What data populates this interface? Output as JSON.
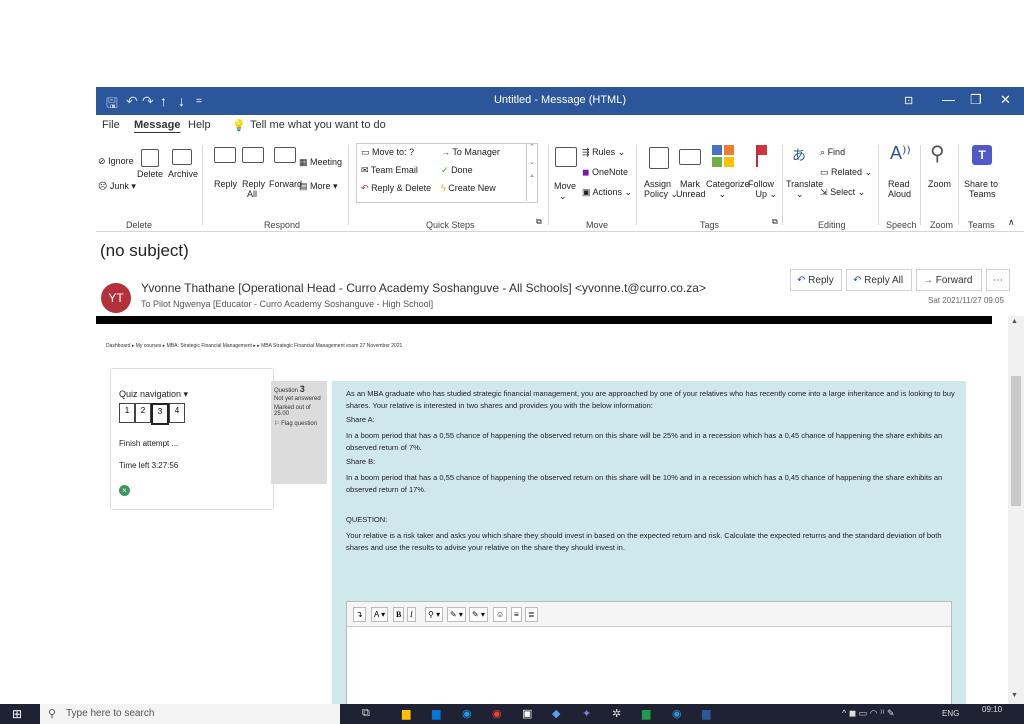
{
  "window": {
    "title": "Untitled  -  Message (HTML)"
  },
  "ribbon_tabs": [
    "File",
    "Message",
    "Help"
  ],
  "tell_me": "Tell me what you want to do",
  "ribbon": {
    "delete": {
      "ignore": "Ignore",
      "junk": "Junk",
      "delete": "Delete",
      "archive": "Archive",
      "group": "Delete"
    },
    "respond": {
      "reply": "Reply",
      "reply_all_1": "Reply",
      "reply_all_2": "All",
      "forward": "Forward",
      "meeting": "Meeting",
      "more": "More",
      "group": "Respond"
    },
    "quick_steps": {
      "move_to": "Move to: ?",
      "team_email": "Team Email",
      "reply_delete": "Reply & Delete",
      "to_manager": "To Manager",
      "done": "Done",
      "create_new": "Create New",
      "group": "Quick Steps"
    },
    "move": {
      "rules": "Rules",
      "onenote": "OneNote",
      "move": "Move",
      "actions": "Actions",
      "group": "Move"
    },
    "tags": {
      "assign_1": "Assign",
      "assign_2": "Policy",
      "mark_1": "Mark",
      "mark_2": "Unread",
      "categorize": "Categorize",
      "follow_1": "Follow",
      "follow_2": "Up",
      "group": "Tags"
    },
    "editing": {
      "translate": "Translate",
      "find": "Find",
      "related": "Related",
      "select": "Select",
      "group": "Editing"
    },
    "speech": {
      "read_1": "Read",
      "read_2": "Aloud",
      "group": "Speech"
    },
    "zoom": {
      "zoom": "Zoom",
      "group": "Zoom"
    },
    "teams": {
      "share_1": "Share to",
      "share_2": "Teams",
      "group": "Teams"
    }
  },
  "message": {
    "subject": "(no subject)",
    "avatar": "YT",
    "from": "Yvonne Thathane [Operational Head - Curro Academy Soshanguve - All Schools] <yvonne.t@curro.co.za>",
    "to": "To   Pilot Ngwenya [Educator - Curro Academy Soshanguve - High School]",
    "date": "Sat 2021/11/27 09:05",
    "reply": "Reply",
    "reply_all": "Reply All",
    "forward": "Forward"
  },
  "page": {
    "breadcrumb": "Dashboard  ▸  My courses  ▸  MBA: Strategic Financial Management  ▸   ▸  MBA Strategic Financial Management exam 27 November 2021",
    "quiz_nav_title": "Quiz navigation ▾",
    "quiz_pages": [
      "1",
      "2",
      "3",
      "4"
    ],
    "finish_attempt": "Finish attempt ...",
    "time_left": "Time left 3:27:56",
    "question_label": "Question",
    "question_number": "3",
    "not_yet": "Not yet answered",
    "marked": "Marked out of 25.00",
    "flag": "Flag question",
    "intro": "As an MBA graduate who has studied strategic financial management, you are approached by one of your relatives who has recently come into a large inheritance and is looking to buy shares. Your relative is interested in two shares and provides you with the below information:",
    "share_a": "Share A:",
    "share_a_text": "In a boom period that has a 0,55 chance of happening the observed return on this share will be 25% and in a recession which has a 0,45 chance of happening the share exhibits an observed return of 7%.",
    "share_b": "Share B:",
    "share_b_text": "In a boom period that has a 0,55 chance of happening the observed return on this share will be 10% and in a recession which has a 0,45 chance of happening the share exhibits an observed return of 17%.",
    "question_heading": "QUESTION:",
    "question_text": "Your relative is a risk taker and asks you which share they should invest in based on the expected return and risk. Calculate the expected returns and the standard deviation of both shares and use the results to advise your relative on the share they should invest in."
  },
  "taskbar": {
    "search": "Type here to search",
    "lang": "ENG",
    "time": "09:10"
  }
}
